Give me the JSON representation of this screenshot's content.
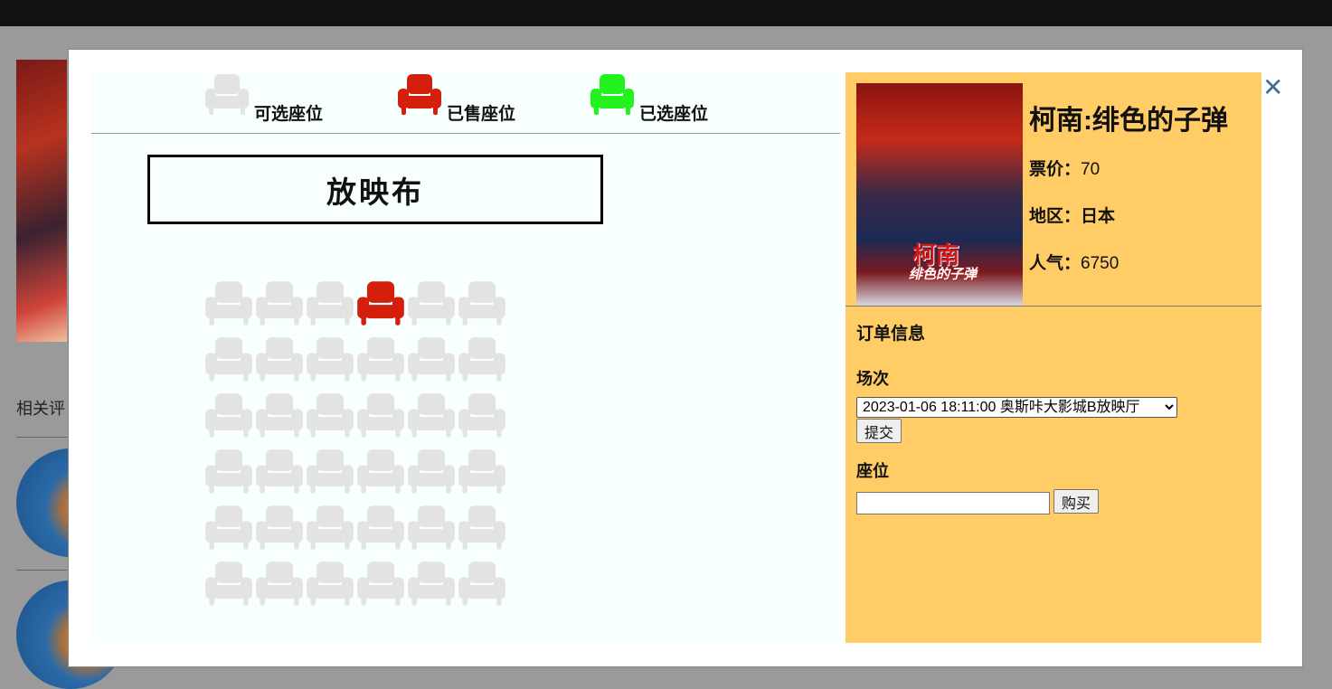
{
  "background_page": {
    "section_title": "相关评"
  },
  "legend": [
    {
      "label": "可选座位",
      "color": "#e3e3e3"
    },
    {
      "label": "已售座位",
      "color": "#d41f0c"
    },
    {
      "label": "已选座位",
      "color": "#22f21e"
    }
  ],
  "screen_label": "放映布",
  "seats": {
    "rows": 6,
    "cols": 6,
    "available_color": "#e3e3e3",
    "sold_color": "#d41f0c",
    "sold": [
      [
        1,
        4
      ]
    ]
  },
  "movie": {
    "poster_title": "柯南",
    "poster_subtitle": "绯色的子弹",
    "title": "柯南:绯色的子弹",
    "price_label": "票价：",
    "price": "70",
    "region_label": "地区：",
    "region": "日本",
    "popularity_label": "人气：",
    "popularity": "6750"
  },
  "order": {
    "heading": "订单信息",
    "session_label": "场次",
    "session_selected": "2023-01-06 18:11:00  奥斯咔大影城B放映厅",
    "submit_label": "提交",
    "seat_label": "座位",
    "seat_value": "",
    "buy_label": "购买"
  },
  "close_symbol": "✕",
  "colors": {
    "panel_bg": "#f8ffff",
    "info_bg": "#ffcc66",
    "close": "#3f6f9f"
  }
}
